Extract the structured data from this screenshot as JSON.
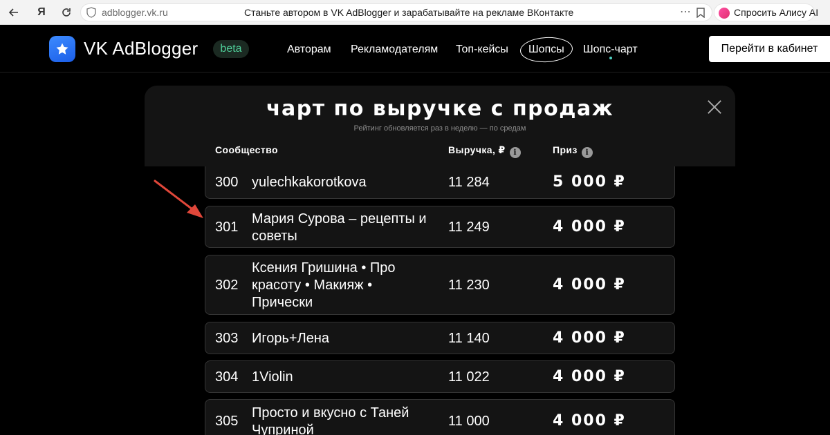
{
  "browser": {
    "url": "adblogger.vk.ru",
    "tab_title": "Станьте автором в VK AdBlogger и зарабатывайте на рекламе ВКонтакте",
    "alice_label": "Спросить Алису AI"
  },
  "header": {
    "logo_text": "VK AdBlogger",
    "beta_label": "beta",
    "nav": [
      "Авторам",
      "Рекламодателям",
      "Топ-кейсы",
      "Шопсы",
      "Шопс-чарт"
    ],
    "cabinet_button": "Перейти в кабинет"
  },
  "modal": {
    "title": "чарт по выручке с продаж",
    "subtitle": "Рейтинг обновляется раз в неделю — по средам",
    "columns": {
      "community": "Сообщество",
      "revenue": "Выручка, ₽",
      "prize": "Приз"
    },
    "rows": [
      {
        "rank": "300",
        "name": "yulechkakorotkova",
        "revenue": "11 284",
        "prize": "5 000 ₽"
      },
      {
        "rank": "301",
        "name": "Мария Сурова – рецепты и советы",
        "revenue": "11 249",
        "prize": "4 000 ₽"
      },
      {
        "rank": "302",
        "name": "Ксения Гришина • Про красоту • Макияж • Прически",
        "revenue": "11 230",
        "prize": "4 000 ₽"
      },
      {
        "rank": "303",
        "name": "Игорь+Лена",
        "revenue": "11 140",
        "prize": "4 000 ₽"
      },
      {
        "rank": "304",
        "name": "1Violin",
        "revenue": "11 022",
        "prize": "4 000 ₽"
      },
      {
        "rank": "305",
        "name": "Просто и вкусно с Таней Чуприной",
        "revenue": "11 000",
        "prize": "4 000 ₽"
      }
    ]
  },
  "colors": {
    "accent_blue": "#2f7cf6",
    "beta_green": "#4fd09a",
    "arrow_red": "#e0473a",
    "modal_bg": "#141414"
  }
}
